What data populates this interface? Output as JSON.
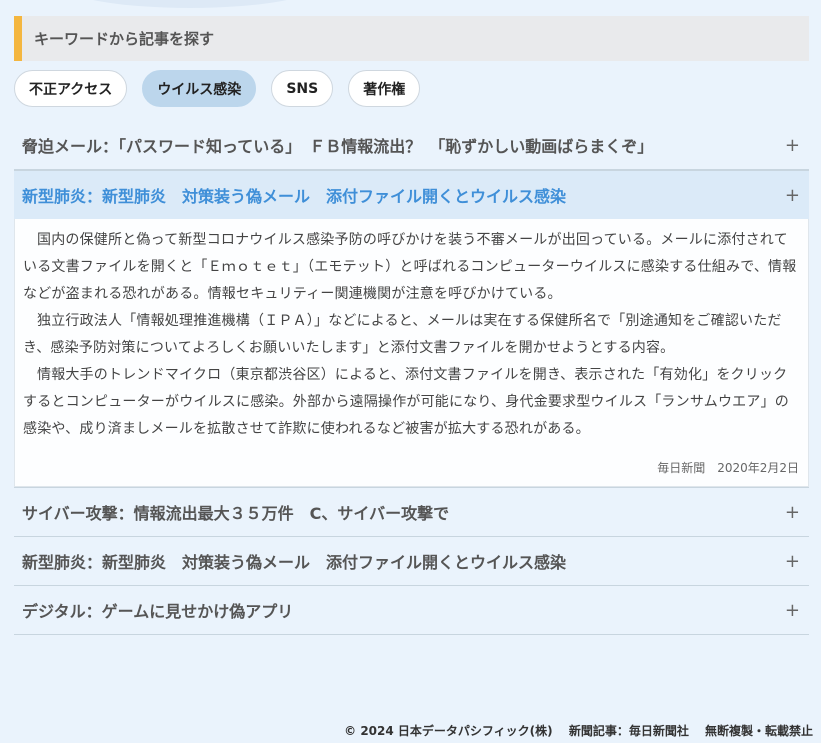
{
  "section": {
    "title": "キーワードから記事を探す"
  },
  "tags": [
    {
      "label": "不正アクセス",
      "active": false
    },
    {
      "label": "ウイルス感染",
      "active": true
    },
    {
      "label": "SNS",
      "active": false
    },
    {
      "label": "著作権",
      "active": false
    }
  ],
  "articles": [
    {
      "title": "脅迫メール：｢パスワード知っている」　ＦＢ情報流出？　「恥ずかしい動画ばらまくぞ」",
      "toggle": "+"
    },
    {
      "title": "新型肺炎：新型肺炎　対策装う偽メール　添付ファイル開くとウイルス感染",
      "toggle": "+",
      "body": [
        "国内の保健所と偽って新型コロナウイルス感染予防の呼びかけを装う不審メールが出回っている。メールに添付されている文書ファイルを開くと「Ｅｍｏｔｅｔ」（エモテット）と呼ばれるコンピューターウイルスに感染する仕組みで、情報などが盗まれる恐れがある。情報セキュリティー関連機関が注意を呼びかけている。",
        "独立行政法人「情報処理推進機構（ＩＰＡ）」などによると、メールは実在する保健所名で「別途通知をご確認いただき、感染予防対策についてよろしくお願いいたします」と添付文書ファイルを開かせようとする内容。",
        "情報大手のトレンドマイクロ（東京都渋谷区）によると、添付文書ファイルを開き、表示された「有効化」をクリックするとコンピューターがウイルスに感染。外部から遠隔操作が可能になり、身代金要求型ウイルス「ランサムウエア」の感染や、成り済ましメールを拡散させて詐欺に使われるなど被害が拡大する恐れがある。"
      ],
      "source": "毎日新聞　2020年2月2日"
    },
    {
      "title": "サイバー攻撃：情報流出最大３５万件　C、サイバー攻撃で",
      "toggle": "+"
    },
    {
      "title": "新型肺炎：新型肺炎　対策装う偽メール　添付ファイル開くとウイルス感染",
      "toggle": "+"
    },
    {
      "title": "デジタル：ゲームに見せかけ偽アプリ",
      "toggle": "+"
    }
  ],
  "footer": {
    "text": "© 2024 日本データパシフィック(株)　 新聞記事：毎日新聞社　 無断複製・転載禁止"
  },
  "colors": {
    "accent_bar": "#f4b63f",
    "active_tag": "#bcd6ec",
    "open_title": "#3f8fd8",
    "page_bg": "#eaf3fc"
  }
}
